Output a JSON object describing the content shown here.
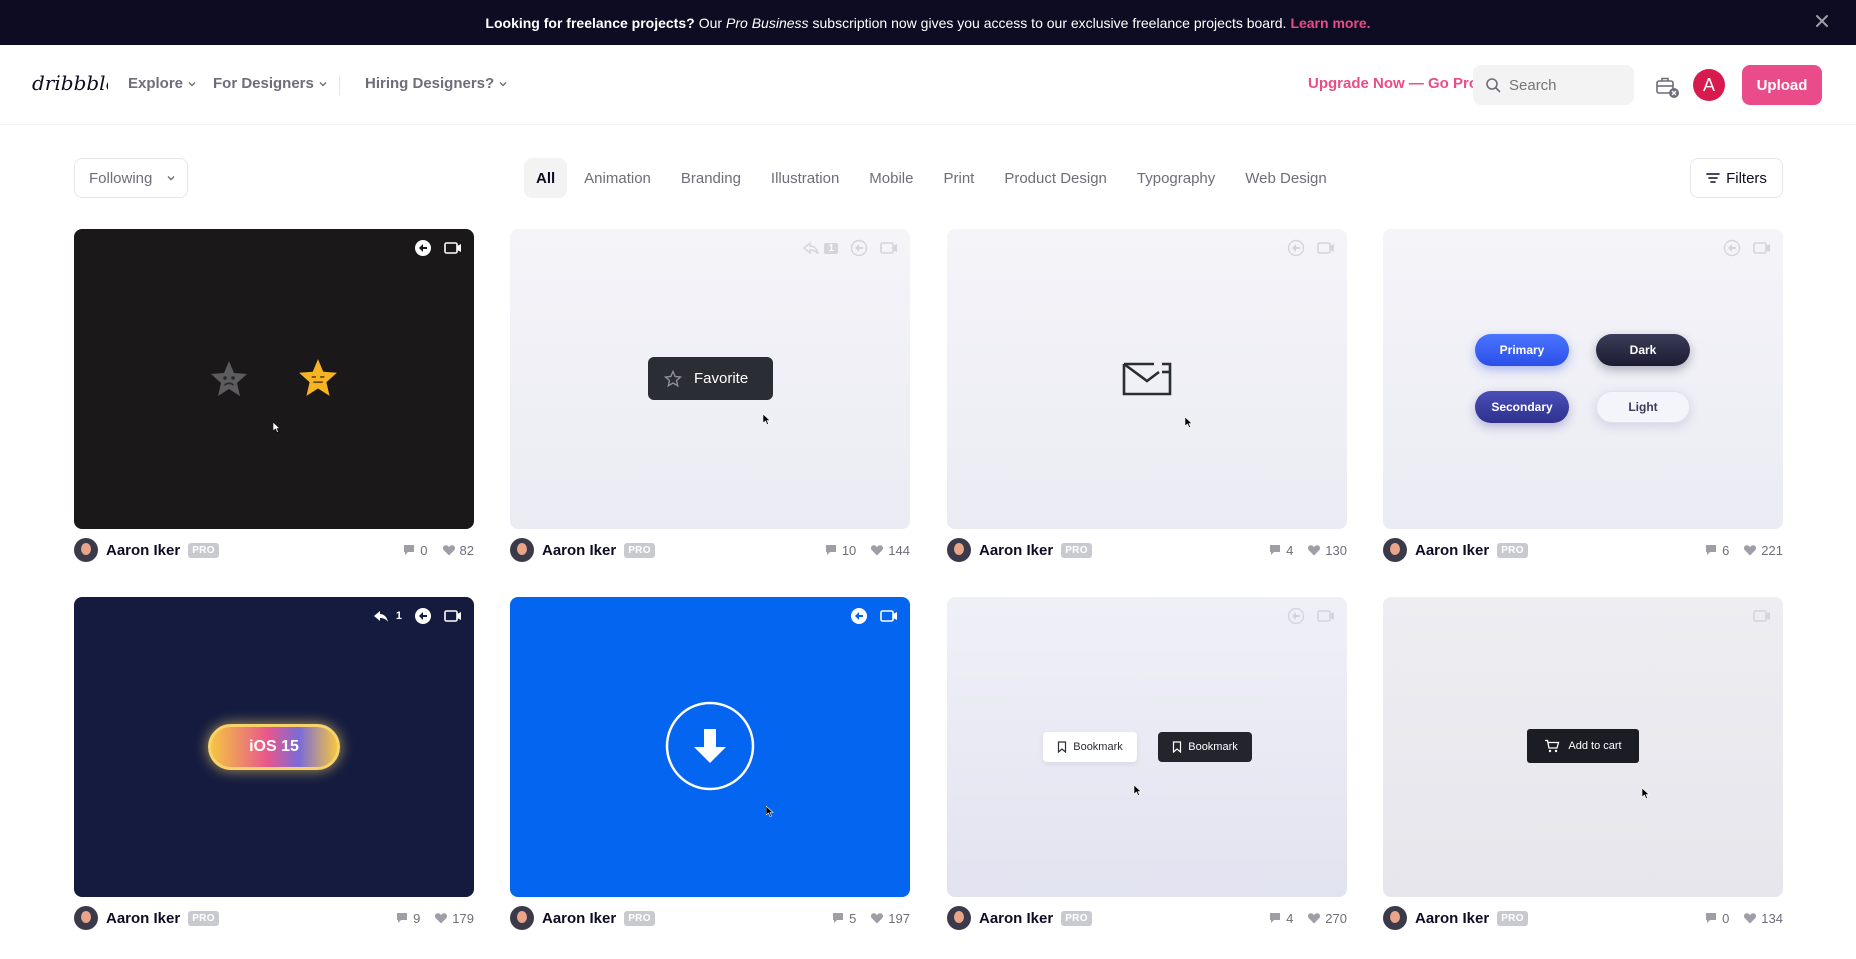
{
  "banner": {
    "lead": "Looking for freelance projects?",
    "text_a": "Our",
    "text_em": "Pro Business",
    "text_b": "subscription now gives you access to our exclusive freelance projects board.",
    "link": "Learn more."
  },
  "nav": {
    "logo": "dribbble",
    "explore": "Explore",
    "for_designers": "For Designers",
    "hiring": "Hiring Designers?",
    "upgrade": "Upgrade Now — Go Pro",
    "search_placeholder": "Search",
    "avatar_letter": "A",
    "upload": "Upload"
  },
  "filterbar": {
    "following": "Following",
    "categories": [
      "All",
      "Animation",
      "Branding",
      "Illustration",
      "Mobile",
      "Print",
      "Product Design",
      "Typography",
      "Web Design"
    ],
    "filters": "Filters"
  },
  "shots": [
    {
      "author": "Aaron Iker",
      "badge": "PRO",
      "comments": "0",
      "likes": "82"
    },
    {
      "author": "Aaron Iker",
      "badge": "PRO",
      "comments": "10",
      "likes": "144",
      "content": "Favorite",
      "rebound_count": "1"
    },
    {
      "author": "Aaron Iker",
      "badge": "PRO",
      "comments": "4",
      "likes": "130"
    },
    {
      "author": "Aaron Iker",
      "badge": "PRO",
      "comments": "6",
      "likes": "221",
      "buttons": [
        "Primary",
        "Dark",
        "Secondary",
        "Light"
      ]
    },
    {
      "author": "Aaron Iker",
      "badge": "PRO",
      "comments": "9",
      "likes": "179",
      "content": "iOS 15",
      "rebound_count": "1"
    },
    {
      "author": "Aaron Iker",
      "badge": "PRO",
      "comments": "5",
      "likes": "197"
    },
    {
      "author": "Aaron Iker",
      "badge": "PRO",
      "comments": "4",
      "likes": "270",
      "buttons": [
        "Bookmark",
        "Bookmark"
      ]
    },
    {
      "author": "Aaron Iker",
      "badge": "PRO",
      "comments": "0",
      "likes": "134",
      "content": "Add to cart"
    }
  ],
  "colors": {
    "brand": "#ea4c89",
    "banner_bg": "#0d0c22",
    "shot_dark": "#1a1819",
    "shot_navy": "#141b3f",
    "shot_blue": "#0365f0"
  }
}
